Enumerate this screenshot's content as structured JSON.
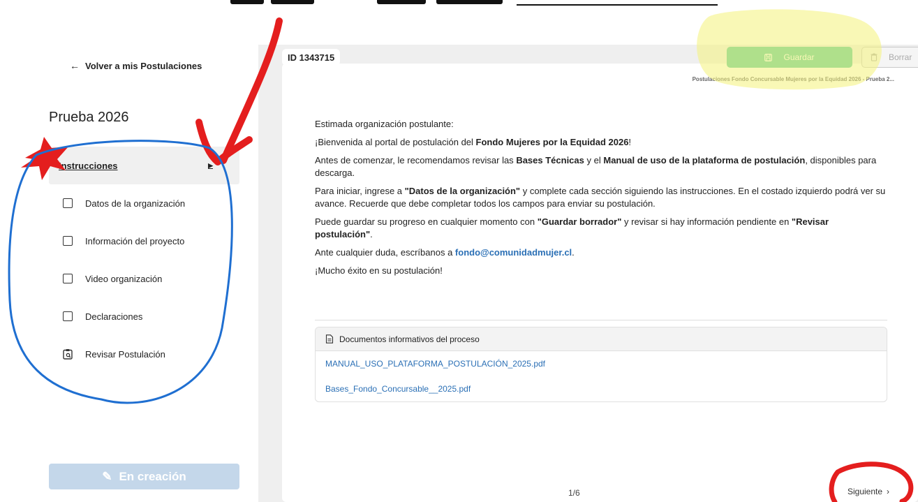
{
  "sidebar": {
    "back_label": "Volver a mis Postulaciones",
    "project_title": "Prueba 2026",
    "items": [
      {
        "label": "Instrucciones"
      },
      {
        "label": "Datos de la organización"
      },
      {
        "label": "Información del proyecto"
      },
      {
        "label": "Video organización"
      },
      {
        "label": "Declaraciones"
      },
      {
        "label": "Revisar Postulación"
      }
    ],
    "status_label": "En creación"
  },
  "header": {
    "id_label": "ID 1343715",
    "save_label": "Guardar",
    "delete_label": "Borrar"
  },
  "card": {
    "breadcrumb": "Postulaciones Fondo Concursable Mujeres por la Equidad 2026 - Prueba 2...",
    "p1": "Estimada organización postulante:",
    "p2_a": "¡Bienvenida al portal de postulación del ",
    "p2_b": "Fondo Mujeres por la Equidad 2026",
    "p2_c": "!",
    "p3_a": "Antes de comenzar, le recomendamos revisar las ",
    "p3_b": "Bases Técnicas",
    "p3_c": " y el ",
    "p3_d": "Manual de uso de la plataforma de postulación",
    "p3_e": ", disponibles para descarga.",
    "p4_a": "Para iniciar, ingrese a ",
    "p4_b": "\"Datos de la organización\"",
    "p4_c": " y complete cada sección siguiendo las instrucciones. En el costado izquierdo podrá ver su avance. Recuerde que debe completar todos los campos para enviar su postulación.",
    "p5_a": "Puede guardar su progreso en cualquier momento con ",
    "p5_b": "\"Guardar borrador\"",
    "p5_c": " y revisar si hay información pendiente en ",
    "p5_d": "\"Revisar postulación\"",
    "p5_e": ".",
    "p6_a": "Ante cualquier duda, escríbanos a ",
    "p6_b": "fondo@comunidadmujer.cl",
    "p6_c": ".",
    "p7": "¡Mucho éxito en su postulación!",
    "docs_title": "Documentos informativos del proceso",
    "docs": [
      {
        "name": "MANUAL_USO_PLATAFORMA_POSTULACIÓN_2025.pdf"
      },
      {
        "name": "Bases_Fondo_Concursable__2025.pdf"
      }
    ],
    "pager": "1/6",
    "next_label": "Siguiente"
  },
  "colors": {
    "save_green": "#5cc9a0",
    "link_blue": "#2a6fb5",
    "highlight_yellow": "#f4f27a",
    "annotation_red": "#e41e1e",
    "annotation_blue": "#1f6fd1",
    "status_disabled": "#c4d7ea"
  }
}
